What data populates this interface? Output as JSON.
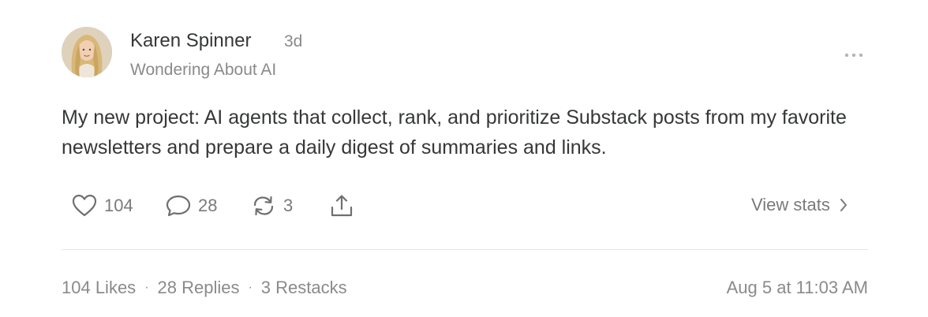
{
  "post": {
    "author": {
      "name": "Karen Spinner",
      "publication": "Wondering About AI",
      "age": "3d"
    },
    "more_icon": "ellipsis-icon",
    "body": "My new project: AI agents that collect, rank, and prioritize Substack posts from my favorite newsletters and prepare a daily digest of summaries and links.",
    "actions": {
      "likes": "104",
      "replies": "28",
      "restacks": "3",
      "icons": [
        "heart-icon",
        "comment-icon",
        "restack-icon",
        "share-icon"
      ]
    },
    "view_stats_label": "View stats",
    "footer": {
      "likes_label": "104 Likes",
      "separator": "·",
      "replies_label": "28 Replies",
      "restacks_label": "3 Restacks",
      "timestamp": "Aug 5 at 11:03 AM"
    }
  },
  "colors": {
    "text_primary": "#363737",
    "text_secondary": "#8a8a8a",
    "divider": "#e6e6e6"
  }
}
